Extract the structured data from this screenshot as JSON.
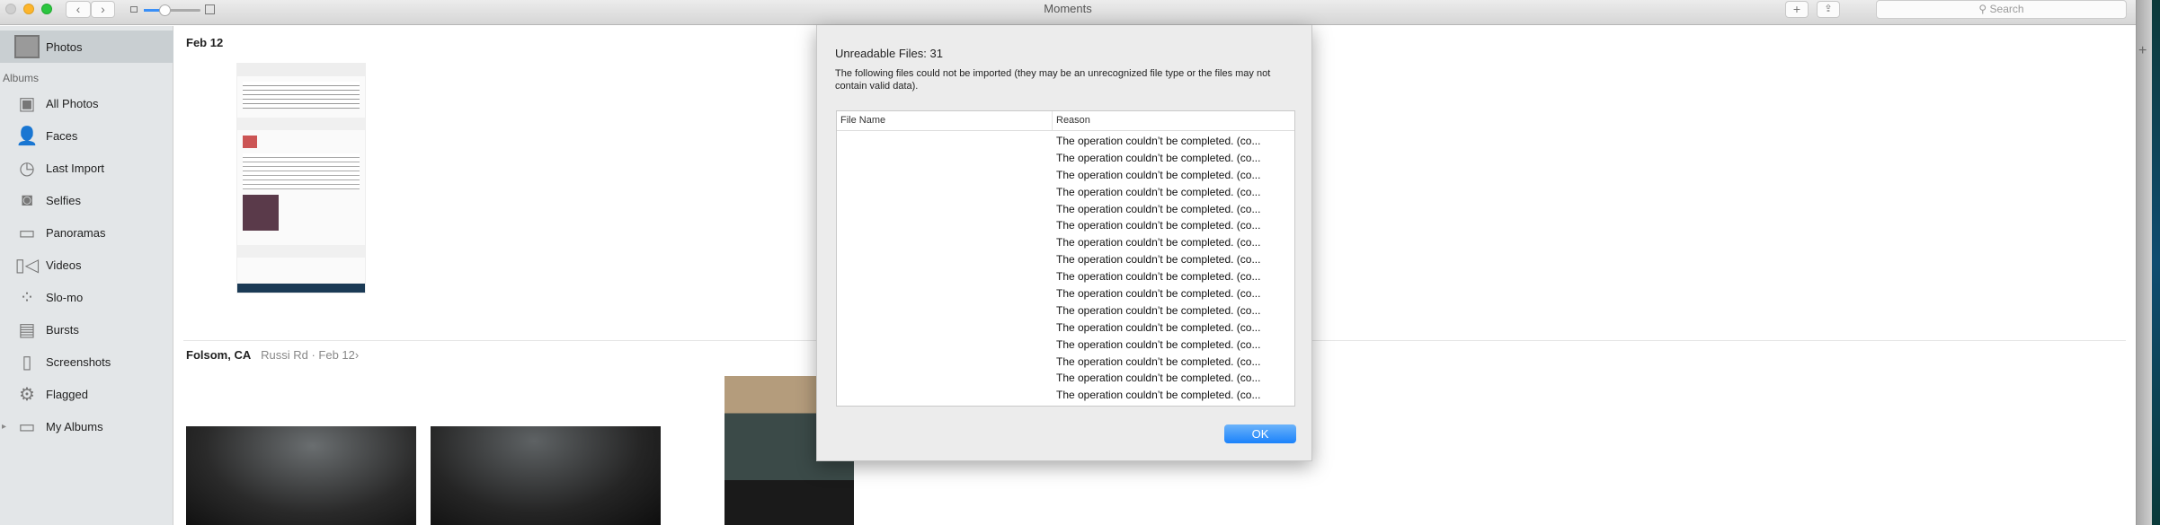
{
  "window": {
    "title": "Moments",
    "search_placeholder": "Search"
  },
  "sidebar": {
    "top_item": "Photos",
    "section_label": "Albums",
    "items": [
      {
        "label": "All Photos",
        "icon": "stack-icon"
      },
      {
        "label": "Faces",
        "icon": "person-icon"
      },
      {
        "label": "Last Import",
        "icon": "clock-icon"
      },
      {
        "label": "Selfies",
        "icon": "camera-icon"
      },
      {
        "label": "Panoramas",
        "icon": "panorama-icon"
      },
      {
        "label": "Videos",
        "icon": "video-icon"
      },
      {
        "label": "Slo-mo",
        "icon": "slomo-icon"
      },
      {
        "label": "Bursts",
        "icon": "bursts-icon"
      },
      {
        "label": "Screenshots",
        "icon": "phone-icon"
      },
      {
        "label": "Flagged",
        "icon": "gear-icon"
      },
      {
        "label": "My Albums",
        "icon": "folder-icon"
      }
    ]
  },
  "moments": [
    {
      "title": "Feb 12"
    },
    {
      "title": "Folsom, CA",
      "subtitle": "Russi Rd",
      "date": "Feb 12"
    }
  ],
  "dialog": {
    "title": "Unreadable Files: 31",
    "message": "The following files could not be imported (they may be an unrecognized file type or the files may not contain valid data).",
    "columns": [
      "File Name",
      "Reason"
    ],
    "rows": [
      "The operation couldn’t be completed. (co...",
      "The operation couldn’t be completed. (co...",
      "The operation couldn’t be completed. (co...",
      "The operation couldn’t be completed. (co...",
      "The operation couldn’t be completed. (co...",
      "The operation couldn’t be completed. (co...",
      "The operation couldn’t be completed. (co...",
      "The operation couldn’t be completed. (co...",
      "The operation couldn’t be completed. (co...",
      "The operation couldn’t be completed. (co...",
      "The operation couldn’t be completed. (co...",
      "The operation couldn’t be completed. (co...",
      "The operation couldn’t be completed. (co...",
      "The operation couldn’t be completed. (co...",
      "The operation couldn’t be completed. (co...",
      "The operation couldn’t be completed. (co..."
    ],
    "ok_label": "OK"
  }
}
